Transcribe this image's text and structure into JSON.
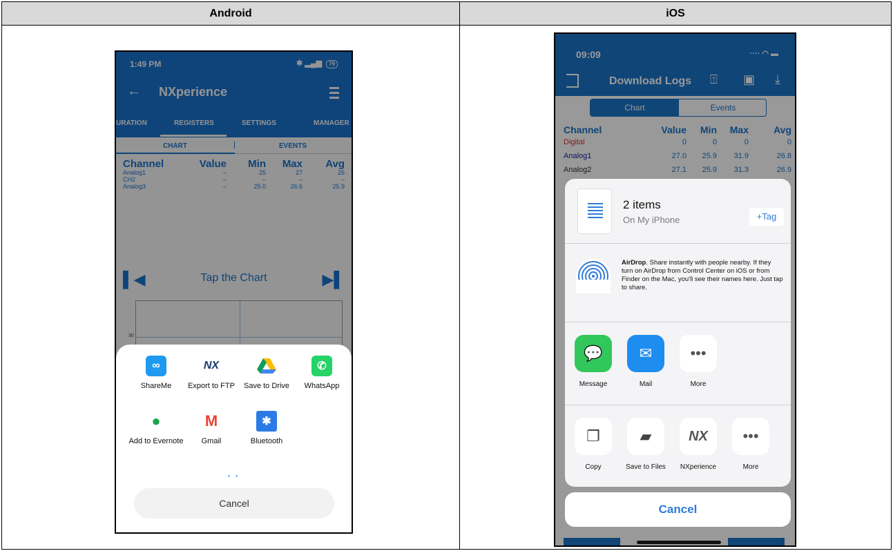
{
  "table": {
    "header_left": "Android",
    "header_right": "iOS"
  },
  "android": {
    "status": {
      "time": "1:49 PM",
      "battery": "79"
    },
    "appbar": {
      "title": "NXperience"
    },
    "tabs": [
      "URATION",
      "REGISTERS",
      "SETTINGS",
      "MANAGER"
    ],
    "subtabs": [
      "CHART",
      "EVENTS"
    ],
    "columns": [
      "Channel",
      "Value",
      "Min",
      "Max",
      "Avg"
    ],
    "rows": [
      [
        "Analog1",
        "–",
        "25",
        "27",
        "26"
      ],
      [
        "CH2",
        "–",
        "–",
        "–",
        "–"
      ],
      [
        "Analog3",
        "–",
        "25.0",
        "26.6",
        "25.9"
      ]
    ],
    "chart": {
      "tap_label": "Tap the Chart",
      "y_tick": "30"
    },
    "share": {
      "apps": [
        "ShareMe",
        "Export to FTP",
        "Save to Drive",
        "WhatsApp",
        "Add to Evernote",
        "Gmail",
        "Bluetooth"
      ],
      "icons": [
        "shareme-icon",
        "nx-icon",
        "drive-icon",
        "whatsapp-icon",
        "evernote-icon",
        "gmail-icon",
        "bluetooth-icon"
      ],
      "nx_glyph": "NX",
      "cancel": "Cancel"
    },
    "colors": {
      "primary": "#1976d2"
    }
  },
  "ios": {
    "status": {
      "time": "09:09"
    },
    "nav": {
      "title": "Download Logs"
    },
    "segments": [
      "Chart",
      "Events"
    ],
    "columns": [
      "Channel",
      "Value",
      "Min",
      "Max",
      "Avg"
    ],
    "rows": [
      [
        "Digital",
        "0",
        "0",
        "0",
        "0"
      ],
      [
        "Analog1",
        "27.0",
        "25.9",
        "31.9",
        "26.8"
      ],
      [
        "Analog2",
        "27.1",
        "25.9",
        "31.3",
        "26.9"
      ]
    ],
    "share": {
      "item_count": "2 items",
      "location": "On My iPhone",
      "tag": "+Tag",
      "airdrop_title": "AirDrop",
      "airdrop_text": ". Share instantly with people nearby. If they turn on AirDrop from Control Center on iOS or from Finder on the Mac, you'll see their names here. Just tap to share.",
      "apps": [
        "Message",
        "Mail",
        "More"
      ],
      "actions": [
        "Copy",
        "Save to Files",
        "NXperience",
        "More"
      ],
      "nx_glyph": "NX",
      "cancel": "Cancel"
    },
    "colors": {
      "primary": "#1a73c7",
      "accent": "#2e7bd8"
    }
  }
}
